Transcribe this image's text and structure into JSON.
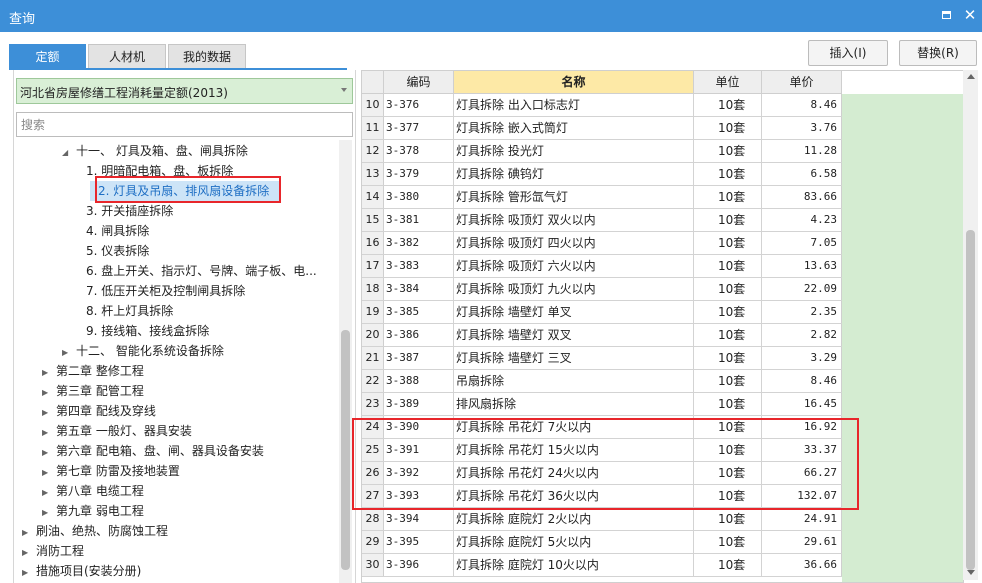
{
  "window": {
    "title": "查询"
  },
  "tabs": [
    {
      "label": "定额",
      "active": true
    },
    {
      "label": "人材机",
      "active": false
    },
    {
      "label": "我的数据",
      "active": false
    }
  ],
  "actions": {
    "insert_label": "插入(I)",
    "replace_label": "替换(R)"
  },
  "left": {
    "quota_book": "河北省房屋修缮工程消耗量定额(2013)",
    "search_placeholder": "搜索",
    "tree": [
      {
        "text": "十一、 灯具及箱、盘、闸具拆除",
        "arrow": "◢"
      },
      {
        "text": "1. 明暗配电箱、盘、板拆除",
        "arrow": ""
      },
      {
        "text": "2. 灯具及吊扇、排风扇设备拆除",
        "arrow": ""
      },
      {
        "text": "3. 开关插座拆除",
        "arrow": ""
      },
      {
        "text": "4. 闸具拆除",
        "arrow": ""
      },
      {
        "text": "5. 仪表拆除",
        "arrow": ""
      },
      {
        "text": "6. 盘上开关、指示灯、号牌、端子板、电...",
        "arrow": ""
      },
      {
        "text": "7. 低压开关柜及控制闸具拆除",
        "arrow": ""
      },
      {
        "text": "8. 杆上灯具拆除",
        "arrow": ""
      },
      {
        "text": "9. 接线箱、接线盒拆除",
        "arrow": ""
      },
      {
        "text": "十二、 智能化系统设备拆除",
        "arrow": "▶"
      },
      {
        "text": "第二章 整修工程",
        "arrow": "▶"
      },
      {
        "text": "第三章 配管工程",
        "arrow": "▶"
      },
      {
        "text": "第四章 配线及穿线",
        "arrow": "▶"
      },
      {
        "text": "第五章 一般灯、器具安装",
        "arrow": "▶"
      },
      {
        "text": "第六章 配电箱、盘、闸、器具设备安装",
        "arrow": "▶"
      },
      {
        "text": "第七章 防雷及接地装置",
        "arrow": "▶"
      },
      {
        "text": "第八章 电缆工程",
        "arrow": "▶"
      },
      {
        "text": "第九章 弱电工程",
        "arrow": "▶"
      },
      {
        "text": "刷油、绝热、防腐蚀工程",
        "arrow": "▶"
      },
      {
        "text": "消防工程",
        "arrow": "▶"
      },
      {
        "text": "措施项目(安装分册)",
        "arrow": "▶"
      }
    ]
  },
  "grid": {
    "headers": {
      "code": "编码",
      "name": "名称",
      "unit": "单位",
      "price": "单价"
    },
    "rows": [
      {
        "idx": "10",
        "code": "3-376",
        "name": "灯具拆除 出入口标志灯",
        "unit": "10套",
        "price": "8.46"
      },
      {
        "idx": "11",
        "code": "3-377",
        "name": "灯具拆除 嵌入式筒灯",
        "unit": "10套",
        "price": "3.76"
      },
      {
        "idx": "12",
        "code": "3-378",
        "name": "灯具拆除 投光灯",
        "unit": "10套",
        "price": "11.28"
      },
      {
        "idx": "13",
        "code": "3-379",
        "name": "灯具拆除 碘钨灯",
        "unit": "10套",
        "price": "6.58"
      },
      {
        "idx": "14",
        "code": "3-380",
        "name": "灯具拆除 管形氙气灯",
        "unit": "10套",
        "price": "83.66"
      },
      {
        "idx": "15",
        "code": "3-381",
        "name": "灯具拆除 吸顶灯 双火以内",
        "unit": "10套",
        "price": "4.23"
      },
      {
        "idx": "16",
        "code": "3-382",
        "name": "灯具拆除 吸顶灯 四火以内",
        "unit": "10套",
        "price": "7.05"
      },
      {
        "idx": "17",
        "code": "3-383",
        "name": "灯具拆除 吸顶灯 六火以内",
        "unit": "10套",
        "price": "13.63"
      },
      {
        "idx": "18",
        "code": "3-384",
        "name": "灯具拆除 吸顶灯 九火以内",
        "unit": "10套",
        "price": "22.09"
      },
      {
        "idx": "19",
        "code": "3-385",
        "name": "灯具拆除 墙壁灯 单叉",
        "unit": "10套",
        "price": "2.35"
      },
      {
        "idx": "20",
        "code": "3-386",
        "name": "灯具拆除 墙壁灯 双叉",
        "unit": "10套",
        "price": "2.82"
      },
      {
        "idx": "21",
        "code": "3-387",
        "name": "灯具拆除 墙壁灯 三叉",
        "unit": "10套",
        "price": "3.29"
      },
      {
        "idx": "22",
        "code": "3-388",
        "name": "吊扇拆除",
        "unit": "10套",
        "price": "8.46"
      },
      {
        "idx": "23",
        "code": "3-389",
        "name": "排风扇拆除",
        "unit": "10套",
        "price": "16.45"
      },
      {
        "idx": "24",
        "code": "3-390",
        "name": "灯具拆除 吊花灯 7火以内",
        "unit": "10套",
        "price": "16.92"
      },
      {
        "idx": "25",
        "code": "3-391",
        "name": "灯具拆除 吊花灯 15火以内",
        "unit": "10套",
        "price": "33.37"
      },
      {
        "idx": "26",
        "code": "3-392",
        "name": "灯具拆除 吊花灯 24火以内",
        "unit": "10套",
        "price": "66.27"
      },
      {
        "idx": "27",
        "code": "3-393",
        "name": "灯具拆除 吊花灯 36火以内",
        "unit": "10套",
        "price": "132.07"
      },
      {
        "idx": "28",
        "code": "3-394",
        "name": "灯具拆除 庭院灯 2火以内",
        "unit": "10套",
        "price": "24.91"
      },
      {
        "idx": "29",
        "code": "3-395",
        "name": "灯具拆除 庭院灯 5火以内",
        "unit": "10套",
        "price": "29.61"
      },
      {
        "idx": "30",
        "code": "3-396",
        "name": "灯具拆除 庭院灯 10火以内",
        "unit": "10套",
        "price": "36.66"
      }
    ]
  }
}
